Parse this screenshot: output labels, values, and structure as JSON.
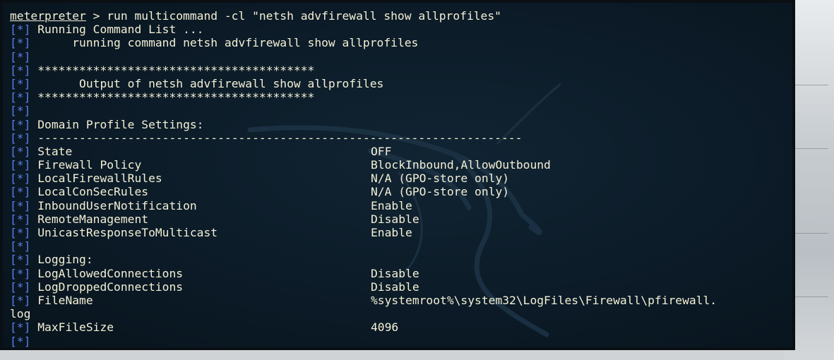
{
  "terminal": {
    "prompt": "meterpreter",
    "command": " > run multicommand -cl \"netsh advfirewall show allprofiles\"",
    "tag": "[*]",
    "lines": [
      {
        "text": "Running Command List ...",
        "value": ""
      },
      {
        "text": "     running command netsh advfirewall show allprofiles",
        "value": ""
      },
      {
        "text": "",
        "value": ""
      },
      {
        "text": "****************************************",
        "value": ""
      },
      {
        "text": "      Output of netsh advfirewall show allprofiles",
        "value": ""
      },
      {
        "text": "****************************************",
        "value": ""
      },
      {
        "text": "",
        "value": ""
      },
      {
        "text": "Domain Profile Settings:",
        "value": ""
      },
      {
        "text": "----------------------------------------------------------------------",
        "value": ""
      },
      {
        "text": "State",
        "value": "OFF"
      },
      {
        "text": "Firewall Policy",
        "value": "BlockInbound,AllowOutbound"
      },
      {
        "text": "LocalFirewallRules",
        "value": "N/A (GPO-store only)"
      },
      {
        "text": "LocalConSecRules",
        "value": "N/A (GPO-store only)"
      },
      {
        "text": "InboundUserNotification",
        "value": "Enable"
      },
      {
        "text": "RemoteManagement",
        "value": "Disable"
      },
      {
        "text": "UnicastResponseToMulticast",
        "value": "Enable"
      },
      {
        "text": "",
        "value": ""
      },
      {
        "text": "Logging:",
        "value": ""
      },
      {
        "text": "LogAllowedConnections",
        "value": "Disable"
      },
      {
        "text": "LogDroppedConnections",
        "value": "Disable"
      },
      {
        "text": "FileName",
        "value": "%systemroot%\\system32\\LogFiles\\Firewall\\pfirewall."
      }
    ],
    "wrap_line": "log",
    "tail_lines": [
      {
        "text": "MaxFileSize",
        "value": "4096"
      },
      {
        "text": "",
        "value": ""
      }
    ]
  },
  "colors": {
    "background": "#0b1a26",
    "text": "#f3f0d6",
    "tag": "#5b7ee8"
  },
  "icons": {
    "background_logo": "kali-dragon-icon"
  }
}
